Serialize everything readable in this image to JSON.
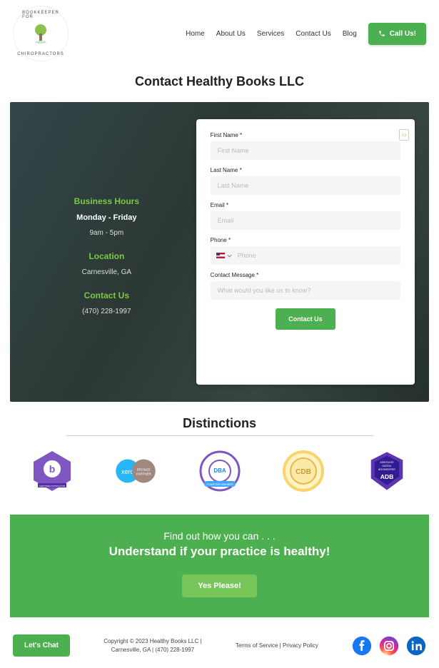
{
  "header": {
    "logo_top": "BOOKKEEPER FOR",
    "logo_bottom": "CHIROPRACTORS",
    "nav": [
      "Home",
      "About Us",
      "Services",
      "Contact Us",
      "Blog"
    ],
    "call_label": "Call Us!"
  },
  "page_title": "Contact Healthy Books LLC",
  "info": {
    "hours_head": "Business Hours",
    "hours_days": "Monday - Friday",
    "hours_time": "9am - 5pm",
    "location_head": "Location",
    "location_value": "Carnesville, GA",
    "contact_head": "Contact Us",
    "phone_value": "(470) 228-1997"
  },
  "form": {
    "first_name_label": "First Name *",
    "first_name_placeholder": "First Name",
    "last_name_label": "Last Name *",
    "last_name_placeholder": "Last Name",
    "email_label": "Email *",
    "email_placeholder": "Email",
    "phone_label": "Phone *",
    "phone_placeholder": "Phone",
    "message_label": "Contact Message *",
    "message_placeholder": "What would you like us to know?",
    "submit_label": "Contact Us"
  },
  "distinctions": {
    "title": "Distinctions",
    "badges": [
      "Bookkeepers Certified Instructor",
      "Xero Bronze Partner",
      "DBA Bookkeeper Accountancy Charter Member",
      "CDB Gold Seal",
      "ADB Associate Digital Bookkeeper"
    ]
  },
  "cta": {
    "lead": "Find out how you can . . .",
    "main": "Understand if your practice is healthy!",
    "button": "Yes Please!"
  },
  "footer": {
    "chat_label": "Let's Chat",
    "copyright_line1": "Copyright © 2023 Healthy Books LLC |",
    "copyright_line2": "Carnesville, GA | (470) 228-1997",
    "tos": "Terms of Service",
    "sep": " | ",
    "privacy": "Privacy Policy"
  },
  "colors": {
    "green": "#4caf50",
    "lime": "#7ac943"
  }
}
